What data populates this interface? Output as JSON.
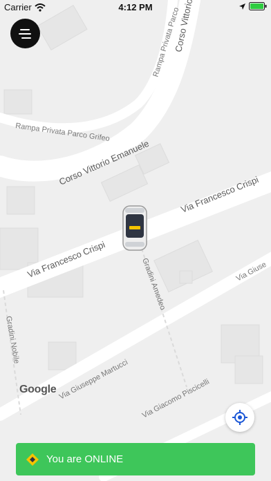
{
  "status_bar": {
    "carrier": "Carrier",
    "time": "4:12 PM"
  },
  "map": {
    "streets": {
      "corso_top": "Corso Vittorio",
      "rampa_parco": "Rampa Privata Parco",
      "rampa_grifeo": "Rampa Privata Parco Grifeo",
      "corso_emanuele": "Corso Vittorio Emanuele",
      "crispi_right": "Via Francesco Crispi",
      "crispi_left": "Via Francesco Crispi",
      "gradini_amedeo": "Gradini Amedeo",
      "gradini_nobile": "Gradini Nobile",
      "martucci": "Via Giuseppe Martucci",
      "piscicelli": "Via Giacomo Piscicelli",
      "via_giuse": "Via Giuse"
    },
    "google_logo": "Google"
  },
  "banner": {
    "status_text": "You are ONLINE",
    "color": "#3ec65a"
  },
  "icons": {
    "menu": "menu-icon",
    "locate": "crosshair-icon",
    "car": "taxi-icon"
  }
}
